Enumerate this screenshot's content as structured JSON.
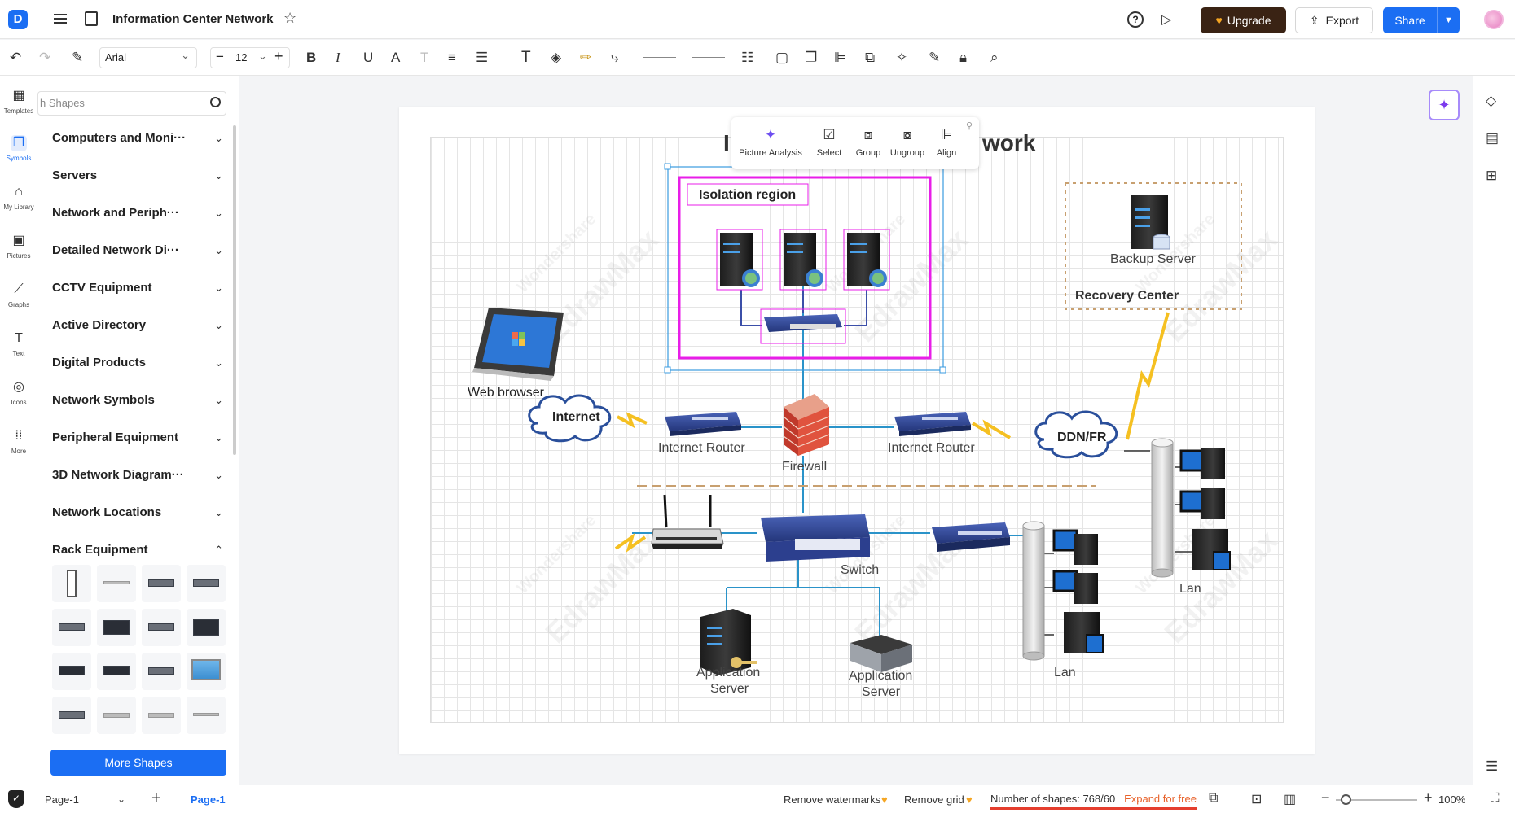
{
  "header": {
    "doc_title": "Information Center Network",
    "upgrade_label": "Upgrade",
    "export_label": "Export",
    "share_label": "Share"
  },
  "toolbar": {
    "font_family": "Arial",
    "font_size": "12"
  },
  "rail": {
    "items": [
      {
        "label": "Templates",
        "icon": "templates-icon"
      },
      {
        "label": "Symbols",
        "icon": "symbols-icon"
      },
      {
        "label": "My Library",
        "icon": "library-icon"
      },
      {
        "label": "Pictures",
        "icon": "pictures-icon"
      },
      {
        "label": "Graphs",
        "icon": "graphs-icon"
      },
      {
        "label": "Text",
        "icon": "text-icon"
      },
      {
        "label": "Icons",
        "icon": "icons-icon"
      },
      {
        "label": "More",
        "icon": "more-icon"
      }
    ]
  },
  "panel": {
    "search_placeholder": "h Shapes",
    "categories": [
      "Computers and Moni···",
      "Servers",
      "Network and Periph···",
      "Detailed Network Di···",
      "CCTV Equipment",
      "Active Directory",
      "Digital Products",
      "Network Symbols",
      "Peripheral Equipment",
      "3D Network Diagram···",
      "Network Locations",
      "Rack Equipment"
    ],
    "more_shapes_label": "More Shapes"
  },
  "float_toolbar": {
    "items": [
      "Picture Analysis",
      "Select",
      "Group",
      "Ungroup",
      "Align"
    ]
  },
  "diagram": {
    "title_left": "I",
    "title_right": "work",
    "isolation_label": "Isolation region",
    "web_browser": "Web browser",
    "internet": "Internet",
    "router_left": "Internet Router",
    "router_right": "Internet Router",
    "firewall": "Firewall",
    "ddn": "DDN/FR",
    "backup_server": "Backup Server",
    "recovery_center": "Recovery Center",
    "switch": "Switch",
    "app_server_1_a": "Application",
    "app_server_1_b": "Server",
    "app_server_2_a": "Application",
    "app_server_2_b": "Server",
    "lan_1": "Lan",
    "lan_2": "Lan",
    "watermark_brand": "EdrawMax",
    "watermark_maker": "Wondershare"
  },
  "bottombar": {
    "page_selector": "Page-1",
    "page_tab": "Page-1",
    "remove_watermarks": "Remove watermarks",
    "remove_grid": "Remove grid",
    "shape_count": "Number of shapes: 768/60",
    "expand": "Expand for free",
    "zoom": "100%"
  },
  "colors": {
    "accent": "#1b6ef3",
    "upgrade_bg": "#3a2314",
    "isolation_border": "#e81ee8",
    "warning": "#e8632c"
  }
}
